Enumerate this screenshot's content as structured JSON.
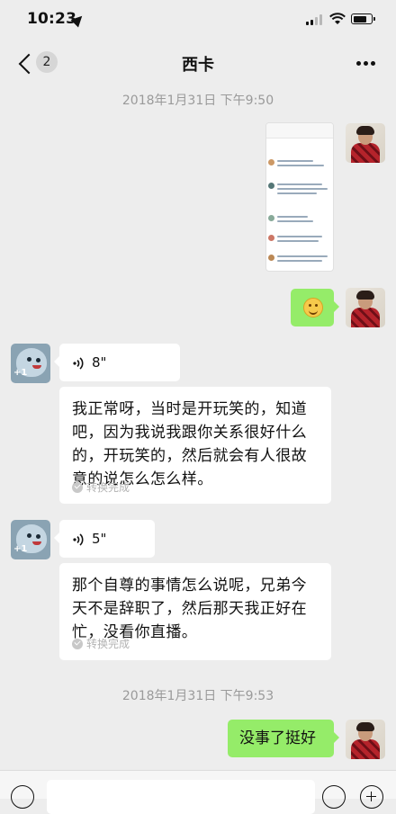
{
  "status_bar": {
    "time": "10:23",
    "location_icon": "location-arrow-icon",
    "signal_icon": "cellular-signal-icon",
    "wifi_icon": "wifi-icon",
    "battery_icon": "battery-icon",
    "battery_level_fraction": 0.75
  },
  "nav": {
    "back_icon": "chevron-left-icon",
    "unread_count": "2",
    "title": "西卡",
    "more_icon": "more-dots-icon"
  },
  "messages": {
    "timestamp_1": "2018年1月31日 下午9:50",
    "image_1": {
      "kind": "screenshot-image",
      "sender": "me"
    },
    "sticker_1": {
      "kind": "emoji",
      "icon": "smiling-face-icon",
      "sender": "me"
    },
    "voice_1": {
      "duration": "8\"",
      "icon": "voice-wave-icon",
      "sender": "other"
    },
    "transcript_1": {
      "text": "我正常呀，当时是开玩笑的，知道吧，因为我说我跟你关系很好什么的，开玩笑的，然后就会有人很故意的说怎么怎么样。",
      "status": "转换完成"
    },
    "voice_2": {
      "duration": "5\"",
      "icon": "voice-wave-icon",
      "sender": "other"
    },
    "transcript_2": {
      "text": "那个自尊的事情怎么说呢，兄弟今天不是辞职了，然后那天我正好在忙，没看你直播。",
      "status": "转换完成"
    },
    "timestamp_2": "2018年1月31日 下午9:53",
    "text_1": {
      "text": "没事了挺好",
      "sender": "me"
    }
  },
  "input_bar": {
    "voice_toggle_icon": "voice-mode-icon",
    "emoji_icon": "emoji-icon",
    "plus_icon": "plus-icon",
    "placeholder": ""
  },
  "colors": {
    "background": "#ededed",
    "my_bubble": "#95ec69",
    "other_bubble": "#ffffff",
    "timestamp": "#9a9a9a"
  }
}
